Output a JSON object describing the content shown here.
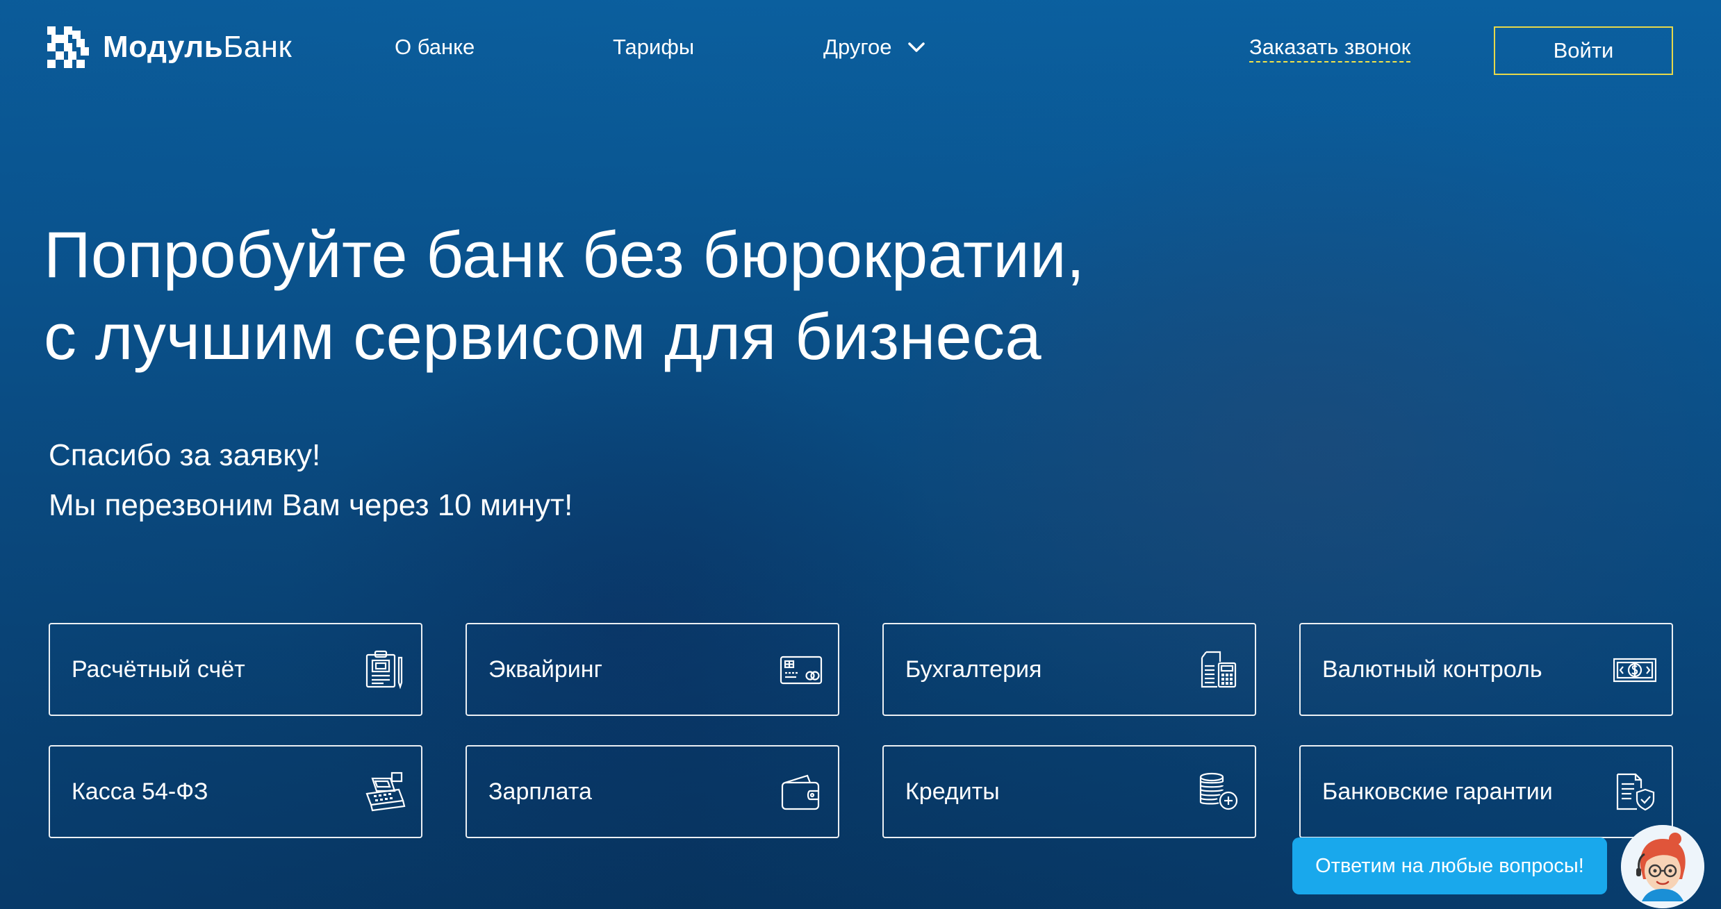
{
  "header": {
    "logo": {
      "bold": "Модуль",
      "light": "Банк"
    },
    "nav": [
      {
        "label": "О банке"
      },
      {
        "label": "Тарифы"
      },
      {
        "label": "Другое"
      }
    ],
    "callback_label": "Заказать звонок",
    "login_label": "Войти"
  },
  "hero": {
    "headline_line1": "Попробуйте банк без бюрократии,",
    "headline_line2": "с лучшим сервисом для бизнеса",
    "thanks_line1": "Спасибо за заявку!",
    "thanks_line2": "Мы перезвоним Вам через 10 минут!"
  },
  "services": [
    {
      "label": "Расчётный счёт",
      "icon": "clipboard-document-icon"
    },
    {
      "label": "Эквайринг",
      "icon": "bank-card-icon"
    },
    {
      "label": "Бухгалтерия",
      "icon": "documents-calculator-icon"
    },
    {
      "label": "Валютный контроль",
      "icon": "dollar-banknote-icon"
    },
    {
      "label": "Касса 54-ФЗ",
      "icon": "cash-register-icon"
    },
    {
      "label": "Зарплата",
      "icon": "wallet-icon"
    },
    {
      "label": "Кредиты",
      "icon": "coin-stack-plus-icon"
    },
    {
      "label": "Банковские гарантии",
      "icon": "document-shield-icon"
    }
  ],
  "chat": {
    "label": "Ответим на любые вопросы!",
    "avatar_icon": "support-agent-avatar-icon"
  },
  "colors": {
    "background_top": "#0b5f9e",
    "background_bottom": "#07335e",
    "accent_yellow": "#e7d84a",
    "chat_blue": "#19a8ec"
  }
}
